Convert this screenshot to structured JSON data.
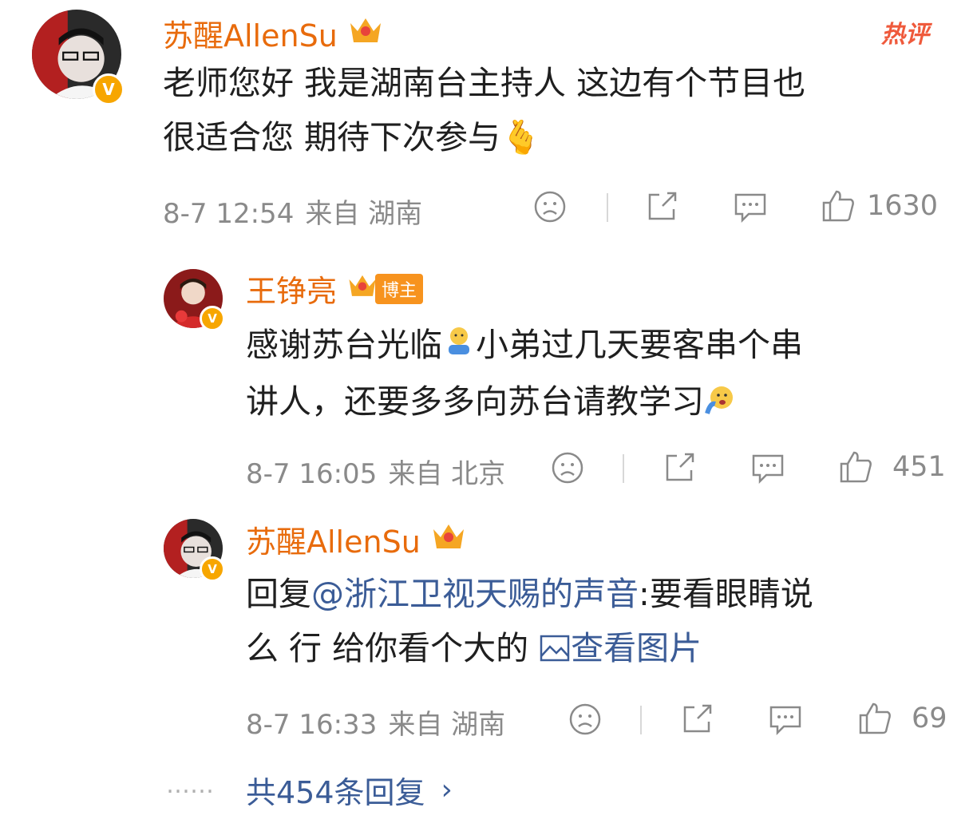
{
  "hot_badge": "热评",
  "comment1": {
    "author": "苏醒AllenSu",
    "text_line1": "老师您好 我是湖南台主持人 这边有个节目也",
    "text_line2": "很适合您 期待下次参与",
    "emoji": "🫰",
    "date": "8-7 12:54",
    "from": "来自 湖南",
    "likes": "1630"
  },
  "reply1": {
    "author": "王铮亮",
    "badge": "博主",
    "text_line1": "感谢苏台光临",
    "text_line1b": "小弟过几天要客串个串",
    "text_line2": "讲人，还要多多向苏台请教学习",
    "date": "8-7 16:05",
    "from": "来自 北京",
    "likes": "451"
  },
  "reply2": {
    "author": "苏醒AllenSu",
    "prefix": "回复",
    "mention": "@浙江卫视天赐的声音",
    "text_line1_rest": ":要看眼睛说",
    "text_line2": "么 行 给你看个大的 ",
    "view_image": "查看图片",
    "date": "8-7 16:33",
    "from": "来自 湖南",
    "likes": "69"
  },
  "more_replies": "共454条回复",
  "ellipsis": "……",
  "colors": {
    "name": "#e86b0c",
    "link": "#3b5c97",
    "meta": "#8a8a8a",
    "verified": "#f7a600"
  }
}
